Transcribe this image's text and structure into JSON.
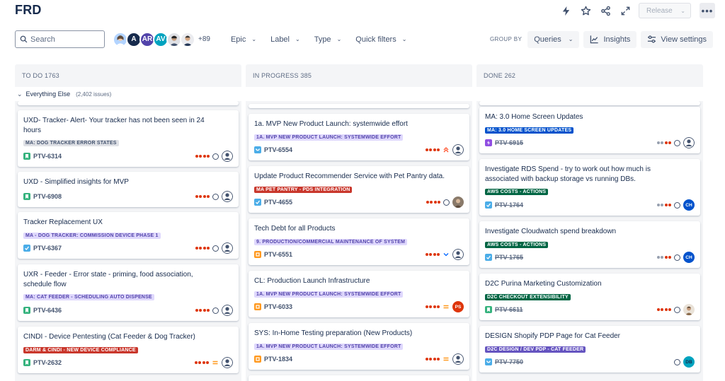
{
  "app": {
    "title": "FRD"
  },
  "header": {
    "release_label": "Release",
    "icons": [
      "lightning-icon",
      "star-icon",
      "share-icon",
      "expand-icon"
    ],
    "more": "•••"
  },
  "toolbar": {
    "search_placeholder": "Search",
    "avatars": [
      {
        "initials": "",
        "color": "#b3d4ff",
        "name": "avatar-photo-1"
      },
      {
        "initials": "A",
        "color": "#172b4d",
        "name": "avatar-a"
      },
      {
        "initials": "AR",
        "color": "#5243aa",
        "name": "avatar-ar"
      },
      {
        "initials": "AV",
        "color": "#00a3bf",
        "name": "avatar-av"
      },
      {
        "initials": "",
        "color": "#42526e",
        "name": "avatar-photo-2"
      },
      {
        "initials": "",
        "color": "#253858",
        "name": "avatar-photo-3"
      }
    ],
    "avatars_more": "+89",
    "filters": [
      "Epic",
      "Label",
      "Type",
      "Quick filters"
    ],
    "group_by_label": "GROUP BY",
    "group_by_value": "Queries",
    "insights_label": "Insights",
    "view_settings_label": "View settings"
  },
  "swimlane": {
    "label": "Everything Else",
    "count": "(2,402 issues)"
  },
  "columns": [
    {
      "header": "TO DO 1763"
    },
    {
      "header": "IN PROGRESS 385"
    },
    {
      "header": "DONE 262"
    }
  ],
  "colors": {
    "purple_lozenge_bg": "#dfd8fd",
    "purple_lozenge_fg": "#5243aa",
    "red_lozenge_bg": "#de350b",
    "orange_lozenge_bg": "#c9372c",
    "blue_lozenge_bg": "#0052cc",
    "green_lozenge_bg": "#006644",
    "grey_lozenge_bg": "#dfe1e6"
  },
  "todo_cards": [
    {
      "title": "UXD- Tracker- Alert- Your tracker has not been seen in 24 hours",
      "lozenge": "MA: DOG TRACKER ERROR STATES",
      "key": "PTV-6314"
    },
    {
      "title": "UXD - Simplified insights for MVP",
      "lozenge": "",
      "key": "PTV-6908"
    },
    {
      "title": "Tracker Replacement UX",
      "lozenge": "MA - DOG TRACKER: COMMISSION DEVICE PHASE 1",
      "key": "PTV-6367"
    },
    {
      "title": "UXR - Feeder - Error state - priming, food association, schedule flow",
      "lozenge": "MA: CAT FEEDER - SCHEDULING AUTO DISPENSE",
      "key": "PTV-6436"
    },
    {
      "title": "CINDI - Device Pentesting (Cat Feeder & Dog Tracker)",
      "lozenge": "DARM & CINDI - NEW DEVICE COMPLIANCE",
      "key": "PTV-2632"
    }
  ],
  "progress_cards": [
    {
      "title": "1a. MVP New Product Launch: systemwide effort",
      "lozenge": "1A. MVP NEW PRODUCT LAUNCH: SYSTEMWIDE EFFORT",
      "key": "PTV-6554"
    },
    {
      "title": "Update Product Recommender Service with Pet Pantry data.",
      "lozenge": "MA PET PANTRY - PDS INTEGRATION",
      "key": "PTV-4655"
    },
    {
      "title": "Tech Debt for all Products",
      "lozenge": "9. PRODUCTION/COMMERCIAL MAINTENANCE OF SYSTEM",
      "key": "PTV-6551"
    },
    {
      "title": "CL: Production Launch Infrastructure",
      "lozenge": "1A. MVP NEW PRODUCT LAUNCH: SYSTEMWIDE EFFORT",
      "key": "PTV-6033",
      "assignee": "PS"
    },
    {
      "title": "SYS: In-Home Testing preparation (New Products)",
      "lozenge": "1A. MVP NEW PRODUCT LAUNCH: SYSTEMWIDE EFFORT",
      "key": "PTV-1834"
    }
  ],
  "done_cards": [
    {
      "title": "MA: 3.0 Home Screen Updates",
      "lozenge": "MA: 3.0 HOME SCREEN UPDATES",
      "key": "PTV-6915"
    },
    {
      "title": "Investigate RDS Spend - try to work out how much is associated with backup storage vs running DBs.",
      "lozenge": "AWS COSTS - ACTIONS",
      "key": "PTV-1764",
      "assignee": "CH"
    },
    {
      "title": "Investigate Cloudwatch spend breakdown",
      "lozenge": "AWS COSTS - ACTIONS",
      "key": "PTV-1765",
      "assignee": "CH"
    },
    {
      "title": "D2C Purina Marketing Customization",
      "lozenge": "D2C CHECKOUT EXTENSIBILITY",
      "key": "PTV-6611"
    },
    {
      "title": "DESIGN Shopify PDP Page for Cat Feeder",
      "lozenge": "D2C DESIGN / DEV PDP - CAT FEEDER",
      "key": "PTV-7750",
      "assignee": "DB"
    }
  ]
}
